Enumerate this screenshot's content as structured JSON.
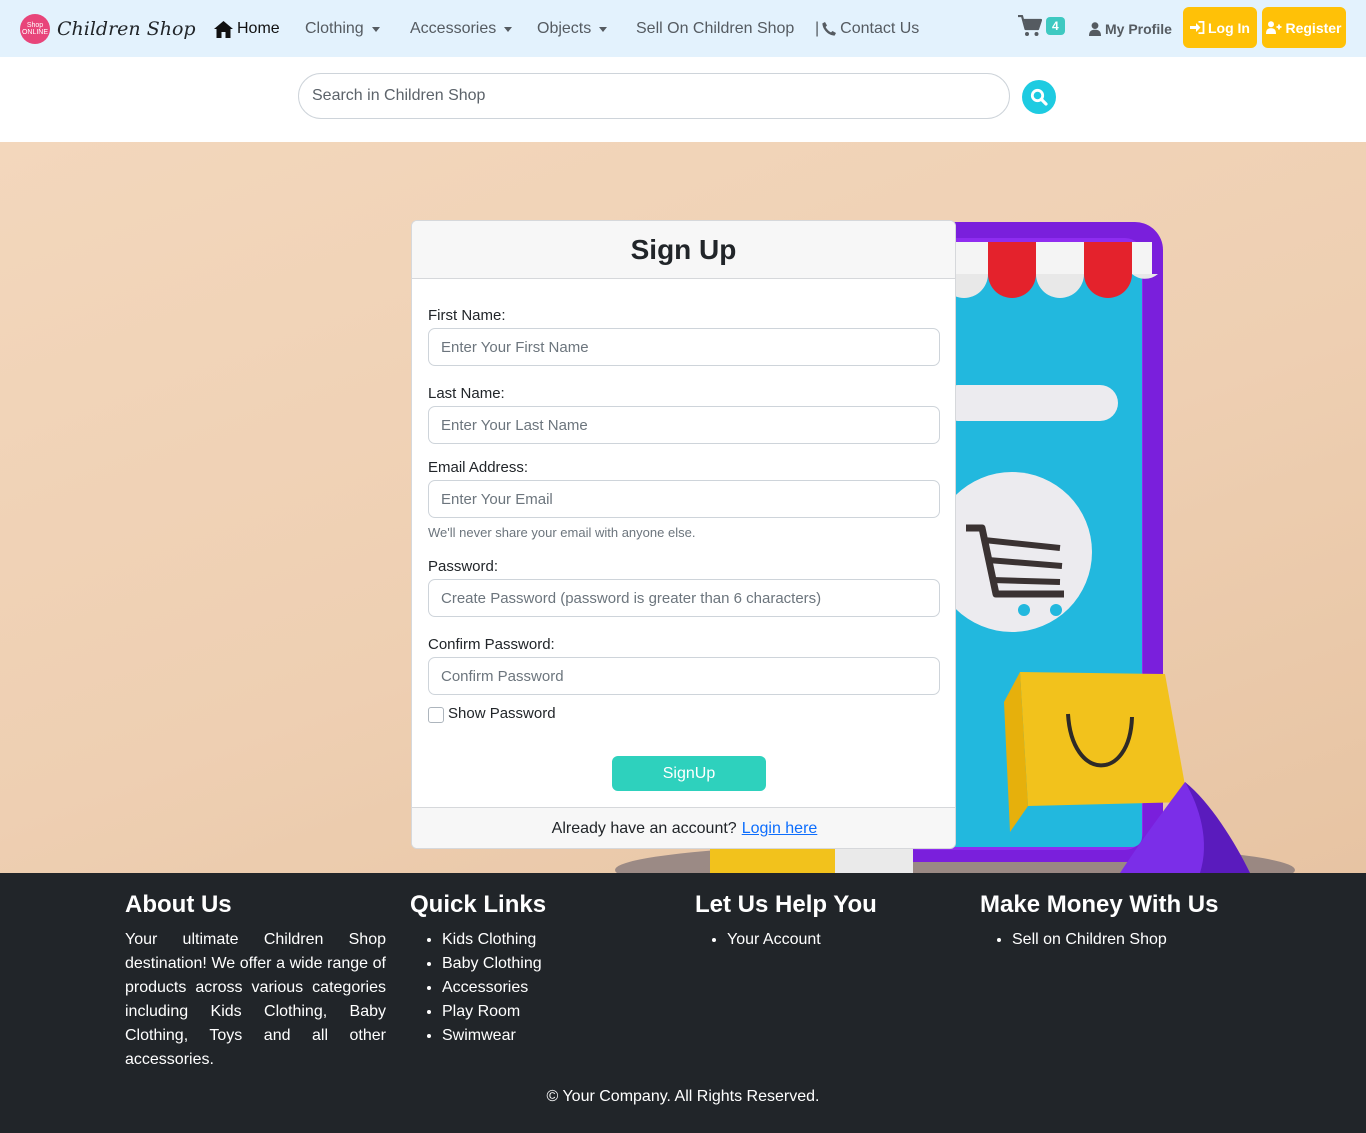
{
  "brand": {
    "logo_line1": "Shop",
    "logo_line2": "ONLINE",
    "name": "Children Shop"
  },
  "nav": {
    "home": "Home",
    "clothing": "Clothing",
    "accessories": "Accessories",
    "objects": "Objects",
    "sell": "Sell On Children Shop",
    "contact_separator": "|",
    "contact": "Contact Us",
    "cart_count": "4",
    "profile": "My Profile",
    "login": "Log In",
    "register": "Register"
  },
  "search": {
    "placeholder": "Search in Children Shop"
  },
  "signup": {
    "title": "Sign Up",
    "first_name_label": "First Name:",
    "first_name_placeholder": "Enter Your First Name",
    "last_name_label": "Last Name:",
    "last_name_placeholder": "Enter Your Last Name",
    "email_label": "Email Address:",
    "email_placeholder": "Enter Your Email",
    "email_help": "We'll never share your email with anyone else.",
    "password_label": "Password:",
    "password_placeholder": "Create Password (password is greater than 6 characters)",
    "confirm_label": "Confirm Password:",
    "confirm_placeholder": "Confirm Password",
    "show_password": "Show Password",
    "submit": "SignUp",
    "footer_text": "Already have an account?",
    "footer_link": "Login here"
  },
  "footer": {
    "about": {
      "title": "About Us",
      "text": "Your ultimate Children Shop destination! We offer a wide range of products across various categories including Kids Clothing, Baby Clothing, Toys and all other accessories."
    },
    "quick_links": {
      "title": "Quick Links",
      "items": [
        "Kids Clothing",
        "Baby Clothing",
        "Accessories",
        "Play Room",
        "Swimwear"
      ]
    },
    "help": {
      "title": "Let Us Help You",
      "items": [
        "Your Account"
      ]
    },
    "money": {
      "title": "Make Money With Us",
      "items": [
        "Sell on Children Shop"
      ]
    },
    "copyright": "© Your Company. All Rights Reserved."
  },
  "colors": {
    "navbar_bg": "#e3f2fd",
    "accent_yellow": "#ffc107",
    "accent_teal": "#2ed1bd",
    "search_button": "#1ecbe1",
    "footer_bg": "#212529",
    "hero_bg": "#eecfb2"
  },
  "icons": {
    "home": "home-icon",
    "cart": "cart-icon",
    "user": "user-icon",
    "login": "sign-in-icon",
    "register": "user-plus-icon",
    "phone": "phone-icon",
    "search": "search-icon"
  }
}
